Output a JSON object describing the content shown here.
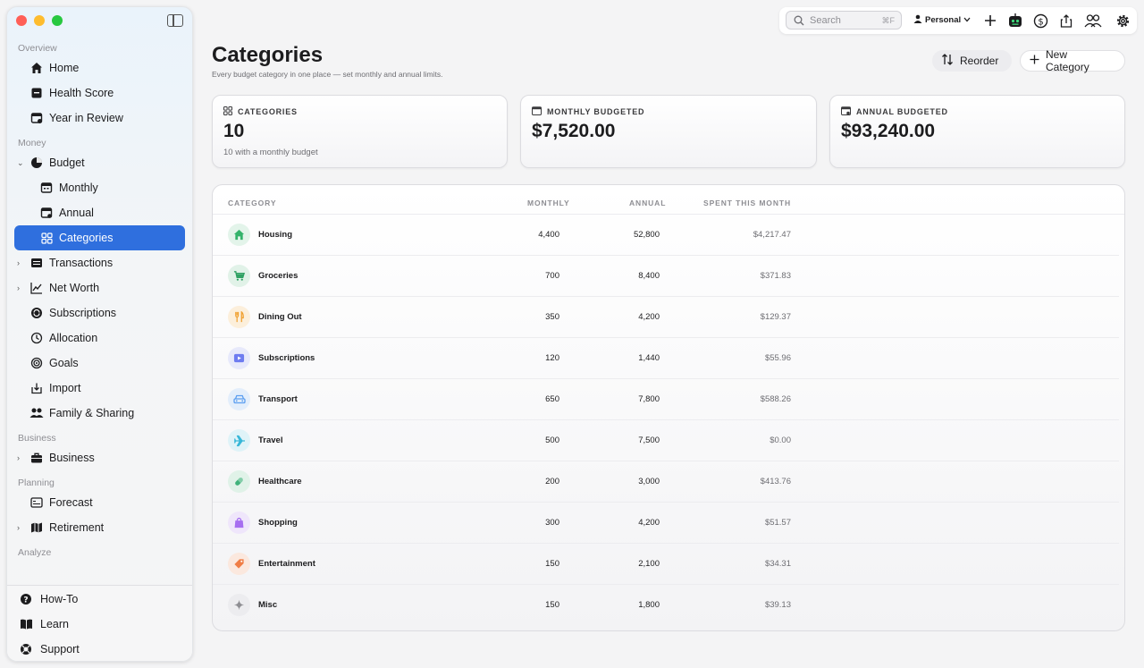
{
  "sidebar": {
    "sections": {
      "overview": "Overview",
      "money": "Money",
      "business": "Business",
      "planning": "Planning",
      "analyze": "Analyze"
    },
    "items": {
      "home": "Home",
      "health_score": "Health Score",
      "year_in_review": "Year in Review",
      "budget": "Budget",
      "monthly": "Monthly",
      "annual": "Annual",
      "categories": "Categories",
      "transactions": "Transactions",
      "net_worth": "Net Worth",
      "subscriptions": "Subscriptions",
      "allocation": "Allocation",
      "goals": "Goals",
      "import": "Import",
      "family_sharing": "Family & Sharing",
      "business": "Business",
      "forecast": "Forecast",
      "retirement": "Retirement"
    },
    "footer": {
      "how_to": "How-To",
      "learn": "Learn",
      "support": "Support"
    }
  },
  "toolbar": {
    "search_placeholder": "Search",
    "search_shortcut": "⌘F",
    "profile": "Personal"
  },
  "page": {
    "title": "Categories",
    "subtitle": "Every budget category in one place — set monthly and annual limits.",
    "reorder_label": "Reorder",
    "new_category_label": "New Category"
  },
  "cards": {
    "categories": {
      "label": "CATEGORIES",
      "value": "10",
      "sub": "10 with a monthly budget"
    },
    "monthly": {
      "label": "MONTHLY BUDGETED",
      "value": "$7,520.00"
    },
    "annual": {
      "label": "ANNUAL BUDGETED",
      "value": "$93,240.00"
    }
  },
  "table": {
    "headers": {
      "category": "CATEGORY",
      "monthly": "MONTHLY",
      "annual": "ANNUAL",
      "spent": "SPENT THIS MONTH"
    },
    "rows": [
      {
        "name": "Housing",
        "monthly": "4,400",
        "annual": "52,800",
        "spent": "$4,217.47",
        "icon": "house-icon",
        "color": "#34b36b",
        "bg": "#e3f4ea"
      },
      {
        "name": "Groceries",
        "monthly": "700",
        "annual": "8,400",
        "spent": "$371.83",
        "icon": "cart-icon",
        "color": "#2fa163",
        "bg": "#e1f2e8"
      },
      {
        "name": "Dining Out",
        "monthly": "350",
        "annual": "4,200",
        "spent": "$129.37",
        "icon": "utensils-icon",
        "color": "#f0a030",
        "bg": "#fcefdb"
      },
      {
        "name": "Subscriptions",
        "monthly": "120",
        "annual": "1,440",
        "spent": "$55.96",
        "icon": "play-icon",
        "color": "#6e7cf0",
        "bg": "#e7e9fb"
      },
      {
        "name": "Transport",
        "monthly": "650",
        "annual": "7,800",
        "spent": "$588.26",
        "icon": "car-icon",
        "color": "#5b9ef0",
        "bg": "#e3eefb"
      },
      {
        "name": "Travel",
        "monthly": "500",
        "annual": "7,500",
        "spent": "$0.00",
        "icon": "airplane-icon",
        "color": "#38b7d8",
        "bg": "#dff3f8"
      },
      {
        "name": "Healthcare",
        "monthly": "200",
        "annual": "3,000",
        "spent": "$413.76",
        "icon": "pill-icon",
        "color": "#3fb27a",
        "bg": "#e0f2e8"
      },
      {
        "name": "Shopping",
        "monthly": "300",
        "annual": "4,200",
        "spent": "$51.57",
        "icon": "bag-icon",
        "color": "#a66ef0",
        "bg": "#efe6fb"
      },
      {
        "name": "Entertainment",
        "monthly": "150",
        "annual": "2,100",
        "spent": "$34.31",
        "icon": "ticket-icon",
        "color": "#f07d45",
        "bg": "#fbe8de"
      },
      {
        "name": "Misc",
        "monthly": "150",
        "annual": "1,800",
        "spent": "$39.13",
        "icon": "sparkle-icon",
        "color": "#8e8e93",
        "bg": "#ececef"
      }
    ]
  },
  "colors": {
    "accent": "#2f6fde"
  }
}
